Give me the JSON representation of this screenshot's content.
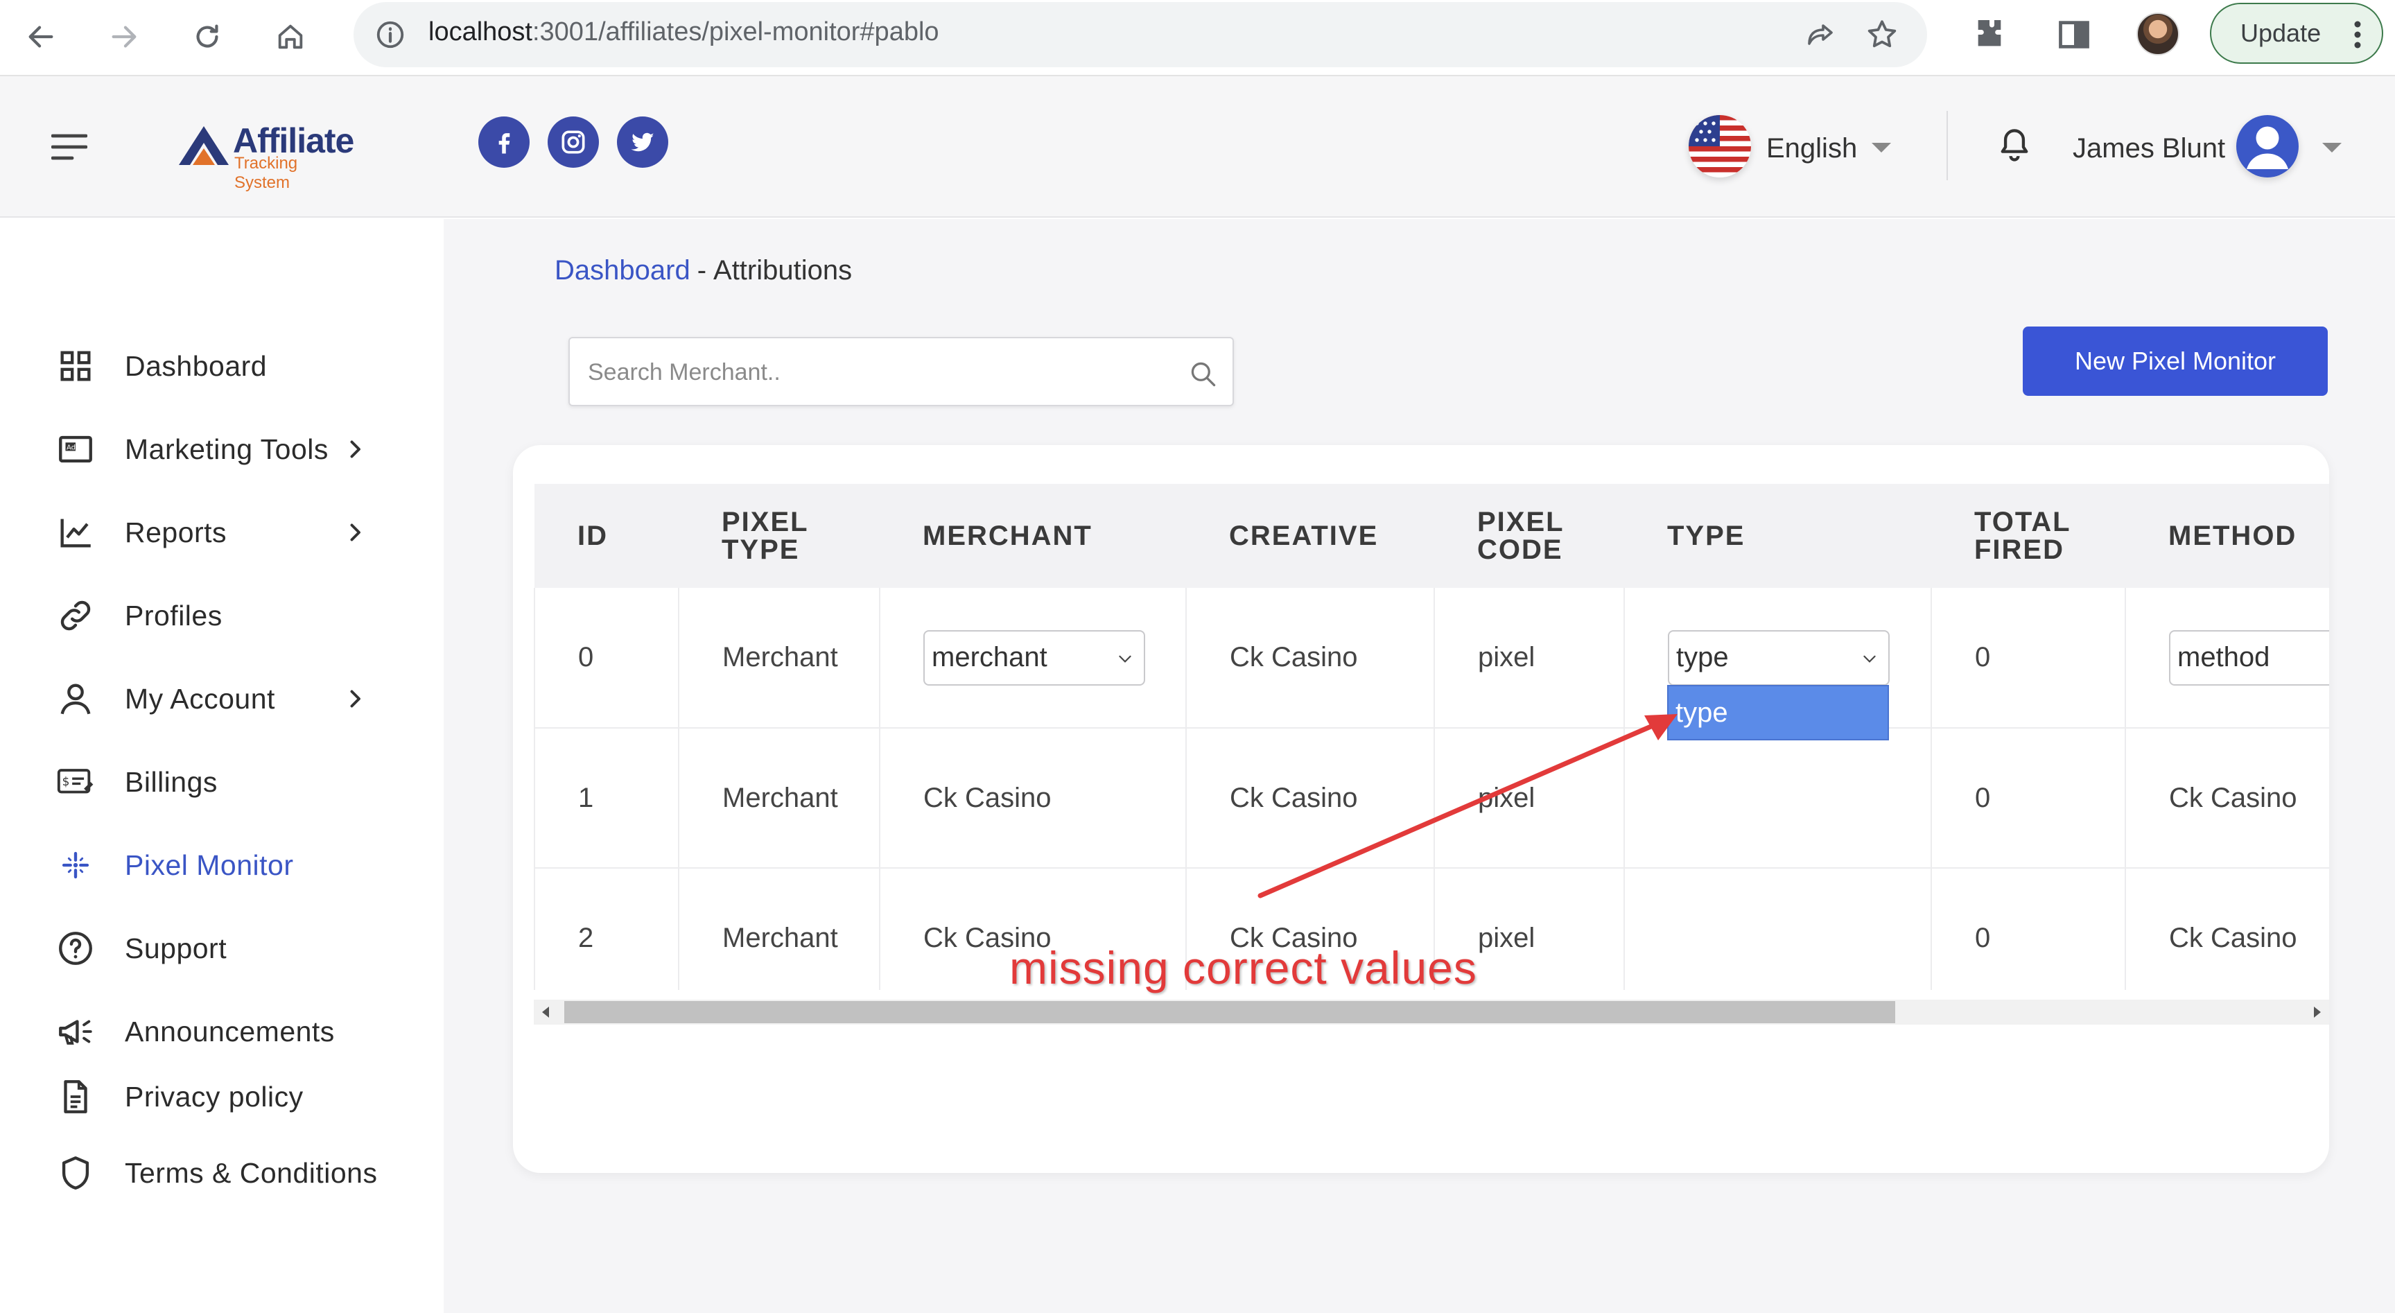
{
  "browser": {
    "url_host": "localhost",
    "url_path": ":3001/affiliates/pixel-monitor#pablo",
    "update_label": "Update"
  },
  "header": {
    "logo_title": "Affiliate",
    "logo_subtitle": "Tracking System",
    "language": "English",
    "user_name": "James Blunt",
    "social": [
      "facebook-icon",
      "instagram-icon",
      "twitter-icon"
    ]
  },
  "sidebar": {
    "items": [
      {
        "label": "Dashboard",
        "icon": "grid-icon",
        "has_chevron": false
      },
      {
        "label": "Marketing Tools",
        "icon": "ad-icon",
        "has_chevron": true
      },
      {
        "label": "Reports",
        "icon": "chart-line-icon",
        "has_chevron": true
      },
      {
        "label": "Profiles",
        "icon": "link-icon",
        "has_chevron": false
      },
      {
        "label": "My Account",
        "icon": "user-icon",
        "has_chevron": true
      },
      {
        "label": "Billings",
        "icon": "billing-icon",
        "has_chevron": false
      },
      {
        "label": "Pixel Monitor",
        "icon": "sparkle-icon",
        "has_chevron": false,
        "active": true
      },
      {
        "label": "Support",
        "icon": "help-icon",
        "has_chevron": false
      },
      {
        "label": "Announcements",
        "icon": "megaphone-icon",
        "has_chevron": false
      },
      {
        "label": "Privacy policy",
        "icon": "document-icon",
        "has_chevron": false
      },
      {
        "label": "Terms & Conditions",
        "icon": "shield-icon",
        "has_chevron": false
      }
    ]
  },
  "main": {
    "breadcrumb": {
      "link": "Dashboard",
      "separator": "-",
      "current": "Attributions"
    },
    "search_placeholder": "Search Merchant..",
    "new_button": "New Pixel Monitor",
    "table": {
      "headers": [
        "ID",
        "PIXEL TYPE",
        "MERCHANT",
        "CREATIVE",
        "PIXEL CODE",
        "TYPE",
        "TOTAL FIRED",
        "METHOD"
      ],
      "rows": [
        {
          "id": "0",
          "pixel_type": "Merchant",
          "merchant": "merchant",
          "creative": "Ck Casino",
          "pixel_code": "pixel",
          "type": "type",
          "total_fired": "0",
          "method": "method"
        },
        {
          "id": "1",
          "pixel_type": "Merchant",
          "merchant": "Ck Casino",
          "creative": "Ck Casino",
          "pixel_code": "pixel",
          "type": "",
          "total_fired": "0",
          "method": "Ck Casino"
        },
        {
          "id": "2",
          "pixel_type": "Merchant",
          "merchant": "Ck Casino",
          "creative": "Ck Casino",
          "pixel_code": "pixel",
          "type": "",
          "total_fired": "0",
          "method": "Ck Casino"
        }
      ],
      "type_dropdown_option": "type"
    }
  },
  "annotation": {
    "text": "missing correct values",
    "color": "#e23a3a"
  },
  "colors": {
    "accent": "#3a55d6",
    "link": "#3a55c5"
  }
}
